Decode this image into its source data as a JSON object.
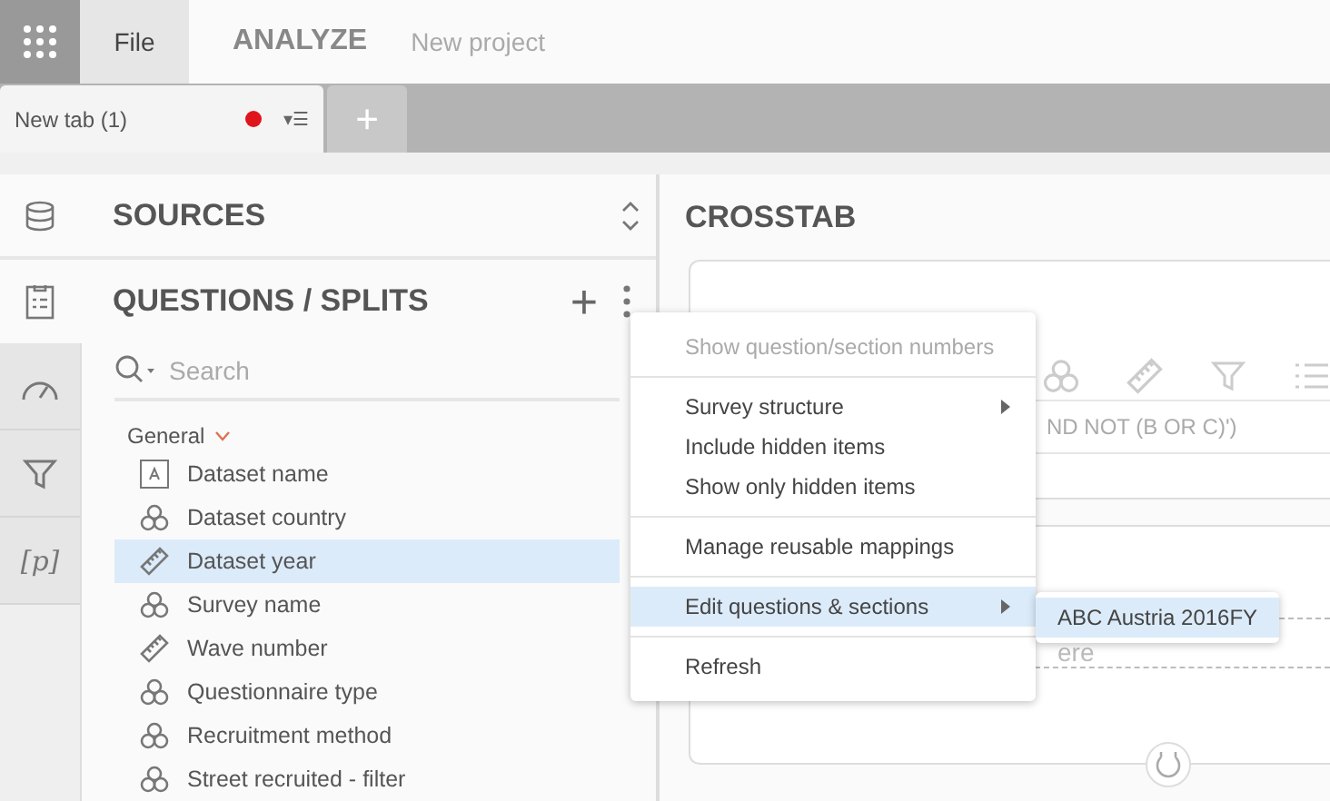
{
  "topbar": {
    "file_label": "File",
    "app_title": "ANALYZE",
    "project_name": "New project"
  },
  "tabs": [
    {
      "label": "New tab (1)",
      "selected": true,
      "unsaved": true,
      "menu_glyph": "▾☰"
    }
  ],
  "new_tab_label": "+",
  "sources": {
    "title": "SOURCES"
  },
  "questions": {
    "title": "QUESTIONS / SPLITS",
    "add_label": "+",
    "search": {
      "placeholder": "Search"
    },
    "tree": [
      {
        "label": "General",
        "expanded": true,
        "children": [
          {
            "label": "Dataset name",
            "kind": "text",
            "selected": false
          },
          {
            "label": "Dataset country",
            "kind": "categorical",
            "selected": false
          },
          {
            "label": "Dataset year",
            "kind": "numeric",
            "selected": true
          },
          {
            "label": "Survey name",
            "kind": "categorical",
            "selected": false
          },
          {
            "label": "Wave number",
            "kind": "numeric",
            "selected": false
          },
          {
            "label": "Questionnaire type",
            "kind": "categorical",
            "selected": false
          },
          {
            "label": "Recruitment method",
            "kind": "categorical",
            "selected": false
          },
          {
            "label": "Street recruited - filter",
            "kind": "categorical",
            "selected": false
          }
        ]
      }
    ]
  },
  "rail": [
    {
      "kind": "gauge"
    },
    {
      "kind": "filter"
    },
    {
      "kind": "param",
      "label": "[p]"
    }
  ],
  "crosstab": {
    "title": "CROSSTAB",
    "filter_text": "ND NOT (B OR C)')",
    "drop_text": "ere"
  },
  "menu": {
    "groups": [
      [
        {
          "label": "Show question/section numbers",
          "disabled": true,
          "submenu": false,
          "selected": false
        }
      ],
      [
        {
          "label": "Survey structure",
          "disabled": false,
          "submenu": true,
          "selected": false
        },
        {
          "label": "Include hidden items",
          "disabled": false,
          "submenu": false,
          "selected": false
        },
        {
          "label": "Show only hidden items",
          "disabled": false,
          "submenu": false,
          "selected": false
        }
      ],
      [
        {
          "label": "Manage reusable mappings",
          "disabled": false,
          "submenu": false,
          "selected": false
        }
      ],
      [
        {
          "label": "Edit questions & sections",
          "disabled": false,
          "submenu": true,
          "selected": true
        }
      ],
      [
        {
          "label": "Refresh",
          "disabled": false,
          "submenu": false,
          "selected": false
        }
      ]
    ],
    "submenu": [
      {
        "label": "ABC Austria 2016FY",
        "selected": true
      }
    ]
  }
}
